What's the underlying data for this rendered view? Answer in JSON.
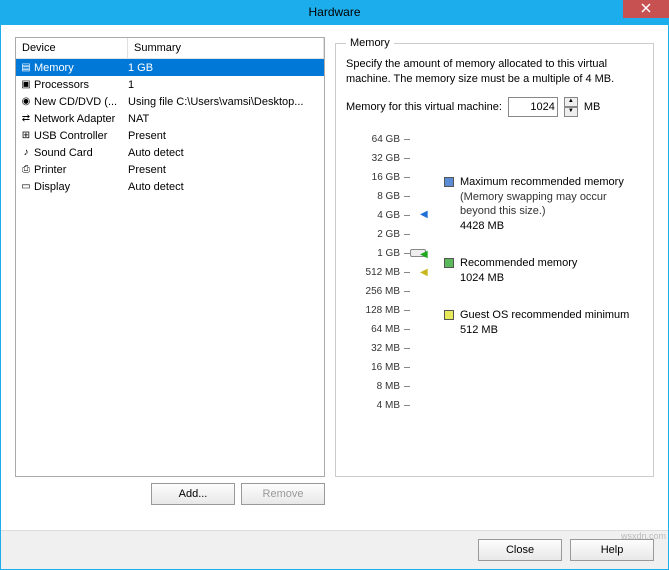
{
  "window": {
    "title": "Hardware"
  },
  "columns": {
    "device": "Device",
    "summary": "Summary"
  },
  "devices": [
    {
      "name": "Memory",
      "summary": "1 GB"
    },
    {
      "name": "Processors",
      "summary": "1"
    },
    {
      "name": "New CD/DVD (...",
      "summary": "Using file C:\\Users\\vamsi\\Desktop..."
    },
    {
      "name": "Network Adapter",
      "summary": "NAT"
    },
    {
      "name": "USB Controller",
      "summary": "Present"
    },
    {
      "name": "Sound Card",
      "summary": "Auto detect"
    },
    {
      "name": "Printer",
      "summary": "Present"
    },
    {
      "name": "Display",
      "summary": "Auto detect"
    }
  ],
  "buttons": {
    "add": "Add...",
    "remove": "Remove",
    "close": "Close",
    "help": "Help"
  },
  "memory": {
    "legend": "Memory",
    "desc": "Specify the amount of memory allocated to this virtual machine. The memory size must be a multiple of 4 MB.",
    "label": "Memory for this virtual machine:",
    "value": "1024",
    "unit": "MB",
    "ticks": [
      "64 GB",
      "32 GB",
      "16 GB",
      "8 GB",
      "4 GB",
      "2 GB",
      "1 GB",
      "512 MB",
      "256 MB",
      "128 MB",
      "64 MB",
      "32 MB",
      "16 MB",
      "8 MB",
      "4 MB"
    ],
    "max": {
      "label": "Maximum recommended memory",
      "note": "(Memory swapping may occur beyond this size.)",
      "value": "4428 MB"
    },
    "rec": {
      "label": "Recommended memory",
      "value": "1024 MB"
    },
    "min": {
      "label": "Guest OS recommended minimum",
      "value": "512 MB"
    }
  },
  "watermark": "wsxdn.com"
}
